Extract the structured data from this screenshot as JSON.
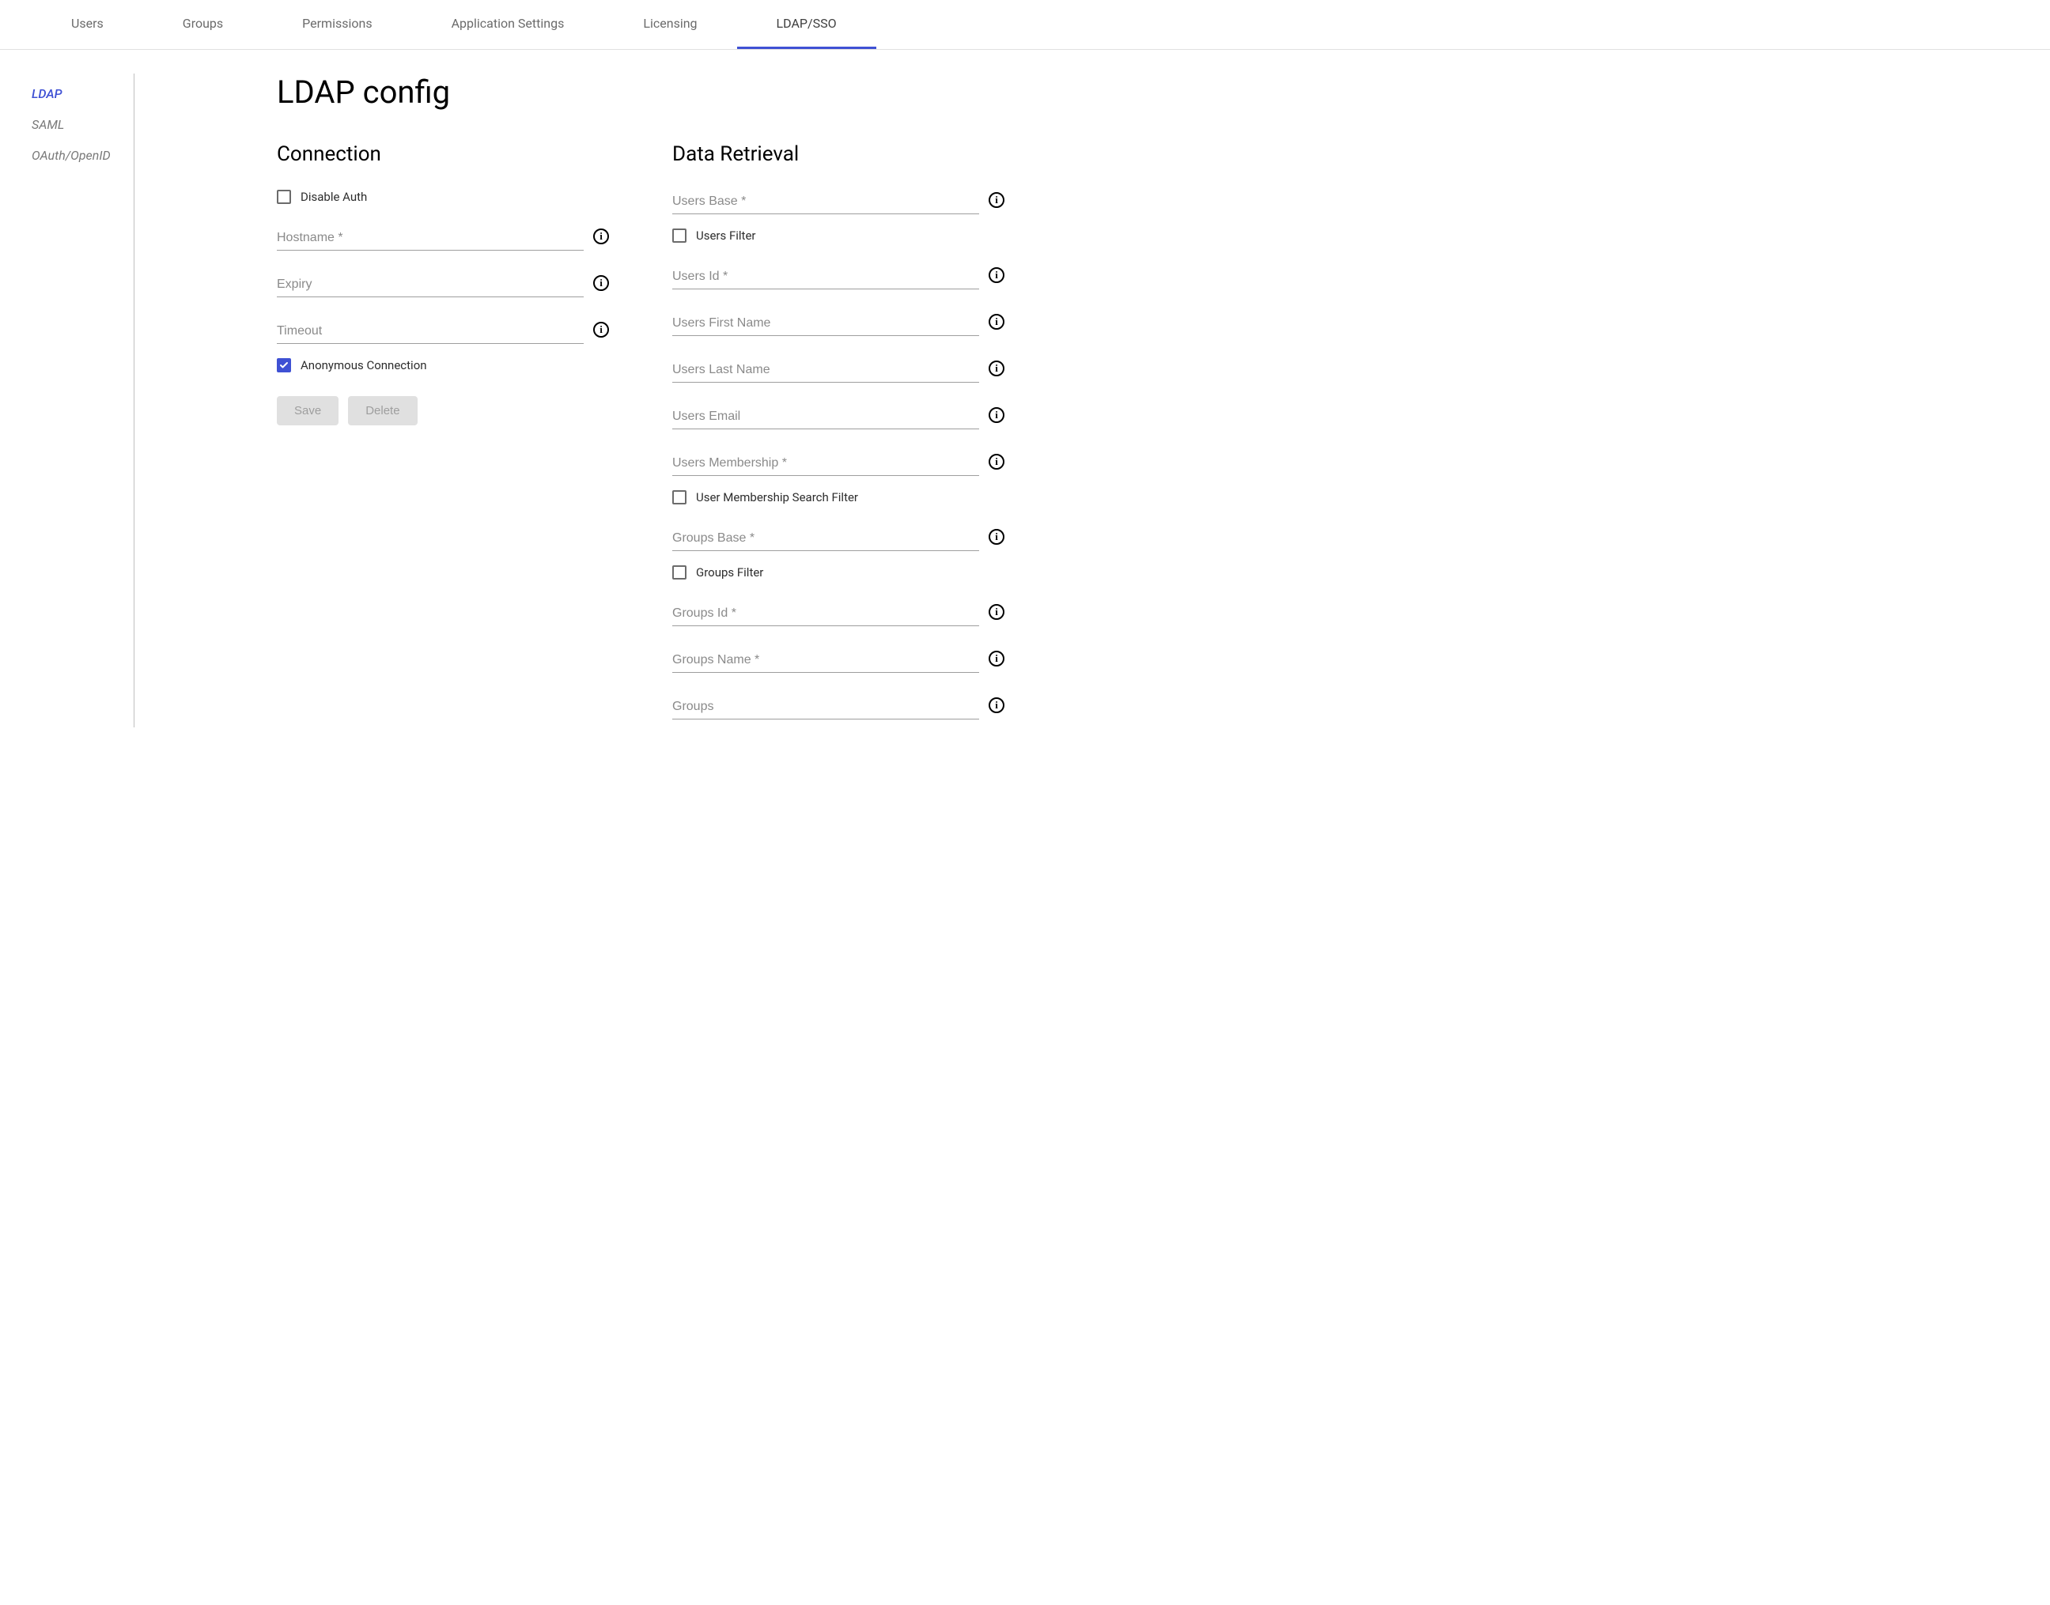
{
  "topTabs": [
    {
      "label": "Users"
    },
    {
      "label": "Groups"
    },
    {
      "label": "Permissions"
    },
    {
      "label": "Application Settings"
    },
    {
      "label": "Licensing"
    },
    {
      "label": "LDAP/SSO",
      "active": true
    }
  ],
  "sideTabs": [
    {
      "label": "LDAP",
      "active": true
    },
    {
      "label": "SAML"
    },
    {
      "label": "OAuth/OpenID"
    }
  ],
  "page": {
    "title": "LDAP config"
  },
  "connection": {
    "heading": "Connection",
    "disable_auth_label": "Disable Auth",
    "disable_auth_checked": false,
    "hostname_placeholder": "Hostname *",
    "hostname_value": "",
    "expiry_placeholder": "Expiry",
    "expiry_value": "",
    "timeout_placeholder": "Timeout",
    "timeout_value": "",
    "anon_conn_label": "Anonymous Connection",
    "anon_conn_checked": true,
    "save_label": "Save",
    "delete_label": "Delete"
  },
  "dataRetrieval": {
    "heading": "Data Retrieval",
    "users_base_placeholder": "Users Base *",
    "users_base_value": "",
    "users_filter_label": "Users Filter",
    "users_filter_checked": false,
    "users_id_placeholder": "Users Id *",
    "users_id_value": "",
    "users_firstname_placeholder": "Users First Name",
    "users_firstname_value": "",
    "users_lastname_placeholder": "Users Last Name",
    "users_lastname_value": "",
    "users_email_placeholder": "Users Email",
    "users_email_value": "",
    "users_membership_placeholder": "Users Membership *",
    "users_membership_value": "",
    "user_membership_filter_label": "User Membership Search Filter",
    "user_membership_filter_checked": false,
    "groups_base_placeholder": "Groups Base *",
    "groups_base_value": "",
    "groups_filter_label": "Groups Filter",
    "groups_filter_checked": false,
    "groups_id_placeholder": "Groups Id *",
    "groups_id_value": "",
    "groups_name_placeholder": "Groups Name *",
    "groups_name_value": "",
    "groups_placeholder": "Groups",
    "groups_value": ""
  }
}
